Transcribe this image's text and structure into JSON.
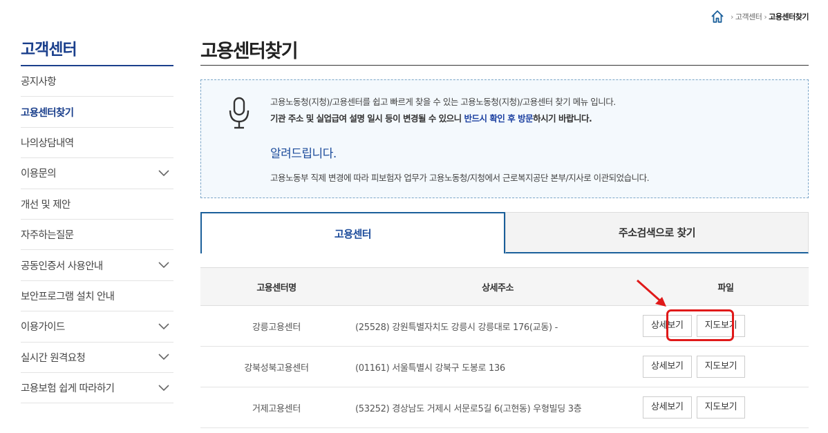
{
  "breadcrumb": {
    "home_icon": "home-icon",
    "items": [
      "고객센터",
      "고용센터찾기"
    ]
  },
  "sidebar": {
    "title": "고객센터",
    "items": [
      {
        "label": "공지사항",
        "expandable": false,
        "active": false
      },
      {
        "label": "고용센터찾기",
        "expandable": false,
        "active": true
      },
      {
        "label": "나의상담내역",
        "expandable": false,
        "active": false
      },
      {
        "label": "이용문의",
        "expandable": true,
        "active": false
      },
      {
        "label": "개선 및 제안",
        "expandable": false,
        "active": false
      },
      {
        "label": "자주하는질문",
        "expandable": false,
        "active": false
      },
      {
        "label": "공동인증서 사용안내",
        "expandable": true,
        "active": false
      },
      {
        "label": "보안프로그램 설치 안내",
        "expandable": false,
        "active": false
      },
      {
        "label": "이용가이드",
        "expandable": true,
        "active": false
      },
      {
        "label": "실시간 원격요청",
        "expandable": true,
        "active": false
      },
      {
        "label": "고용보험 쉽게 따라하기",
        "expandable": true,
        "active": false
      }
    ]
  },
  "page": {
    "title": "고용센터찾기"
  },
  "notice": {
    "icon": "microphone-icon",
    "line1": "고용노동청(지청)/고용센터를 쉽고 빠르게 찾을 수 있는 고용노동청(지청)/고용센터 찾기 메뉴 입니다.",
    "line2_pre": "기관 주소 및 실업급여 설명 일시 등이 변경될 수 있으니 ",
    "line2_highlight": "반드시 확인 후 방문",
    "line2_post": "하시기 바랍니다.",
    "heading": "알려드립니다.",
    "line3": "고용노동부 직제 변경에 따라 피보험자 업무가 고용노동청/지청에서 근로복지공단 본부/지사로 이관되었습니다."
  },
  "tabs": [
    {
      "label": "고용센터",
      "active": true
    },
    {
      "label": "주소검색으로 찾기",
      "active": false
    }
  ],
  "table": {
    "headers": [
      "고용센터명",
      "상세주소",
      "파일"
    ],
    "rows": [
      {
        "name": "강릉고용센터",
        "address": "(25528) 강원특별자치도 강릉시 강릉대로 176(교동) -",
        "btn_detail": "상세보기",
        "btn_map": "지도보기"
      },
      {
        "name": "강북성북고용센터",
        "address": "(01161) 서울특별시 강북구 도봉로 136",
        "btn_detail": "상세보기",
        "btn_map": "지도보기"
      },
      {
        "name": "거제고용센터",
        "address": "(53252) 경상남도 거제시 서문로5길 6(고현동) 우형빌딩 3층",
        "btn_detail": "상세보기",
        "btn_map": "지도보기"
      }
    ]
  },
  "colors": {
    "primary": "#1a3f8c",
    "annotation": "#e01919"
  }
}
